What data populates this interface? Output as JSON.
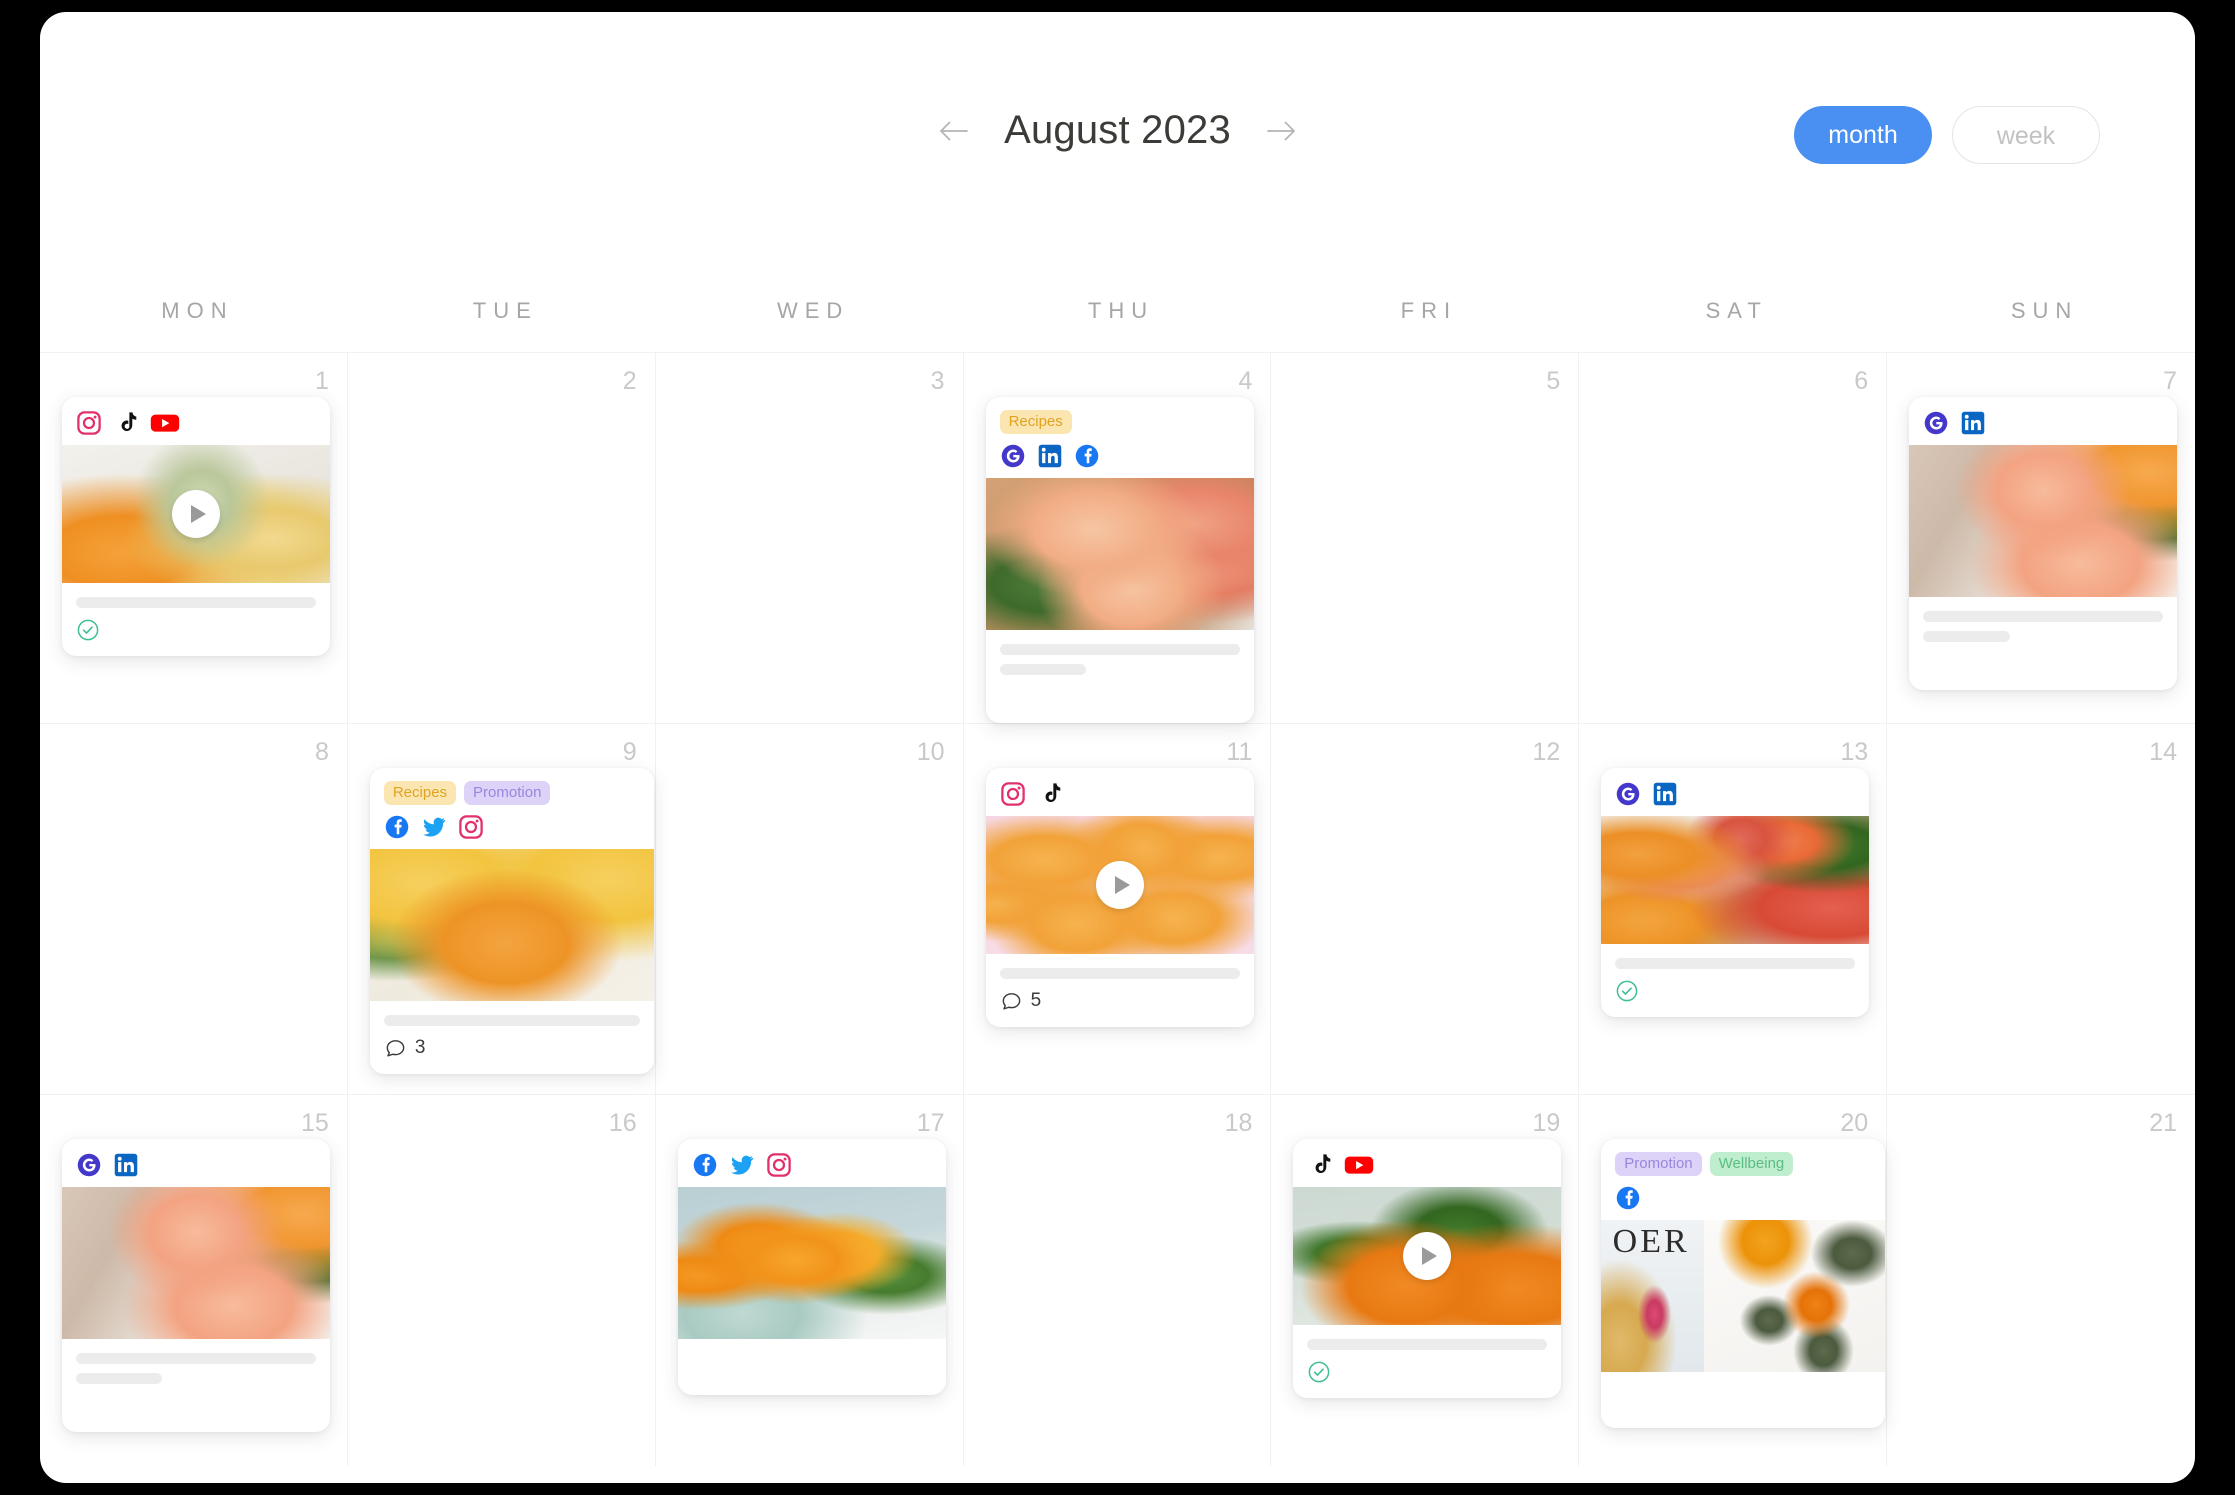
{
  "header": {
    "month_title": "August 2023",
    "prev_label": "previous month",
    "next_label": "next month",
    "view_month": "month",
    "view_week": "week"
  },
  "weekdays": [
    "MON",
    "TUE",
    "WED",
    "THU",
    "FRI",
    "SAT",
    "SUN"
  ],
  "colors": {
    "accent": "#4a90f2",
    "tag_recipes_bg": "#fbe6b2",
    "tag_recipes_fg": "#e0a321",
    "tag_promotion_bg": "#ddd2f7",
    "tag_promotion_fg": "#9b86dd",
    "tag_wellbeing_bg": "#bfeecf",
    "tag_wellbeing_fg": "#5bbd84",
    "status_approved": "#3fbf8f",
    "grid_line": "#f1f1f1",
    "date_number": "#c9c9c9"
  },
  "days": [
    {
      "date": "1",
      "post": {
        "tags": [],
        "socials": [
          "instagram",
          "tiktok",
          "youtube"
        ],
        "media": "pineapple-melon-juice",
        "video": true,
        "bars": [
          "full"
        ],
        "status": "approved",
        "comments": null
      }
    },
    {
      "date": "2",
      "post": null
    },
    {
      "date": "3",
      "post": null
    },
    {
      "date": "4",
      "post": {
        "tags": [
          "Recipes"
        ],
        "socials": [
          "google",
          "linkedin",
          "facebook"
        ],
        "media": "grapefruit-cocktails-board",
        "video": false,
        "bars": [
          "full",
          "short"
        ],
        "status": null,
        "comments": null
      }
    },
    {
      "date": "5",
      "post": null
    },
    {
      "date": "6",
      "post": null
    },
    {
      "date": "7",
      "post": {
        "tags": [],
        "socials": [
          "google",
          "linkedin"
        ],
        "media": "grapefruit-cocktails-linen",
        "video": false,
        "bars": [
          "full",
          "short"
        ],
        "status": null,
        "comments": null
      }
    },
    {
      "date": "8",
      "post": null
    },
    {
      "date": "9",
      "post": {
        "tags": [
          "Recipes",
          "Promotion"
        ],
        "socials": [
          "facebook",
          "twitter",
          "instagram"
        ],
        "media": "mango-smoothie-glass",
        "video": false,
        "bars": [
          "full"
        ],
        "status": null,
        "comments": "3"
      }
    },
    {
      "date": "10",
      "post": null
    },
    {
      "date": "11",
      "post": {
        "tags": [],
        "socials": [
          "instagram",
          "tiktok"
        ],
        "media": "mango-chips-pink",
        "video": true,
        "bars": [
          "full"
        ],
        "status": null,
        "comments": "5"
      }
    },
    {
      "date": "12",
      "post": null
    },
    {
      "date": "13",
      "post": {
        "tags": [],
        "socials": [
          "google",
          "linkedin"
        ],
        "media": "citrus-cutting-board",
        "video": false,
        "bars": [
          "full"
        ],
        "status": "approved",
        "comments": null
      }
    },
    {
      "date": "14",
      "post": null
    },
    {
      "date": "15",
      "post": {
        "tags": [],
        "socials": [
          "google",
          "linkedin"
        ],
        "media": "grapefruit-cocktails-linen",
        "video": false,
        "bars": [
          "full",
          "short"
        ],
        "status": null,
        "comments": null
      }
    },
    {
      "date": "16",
      "post": null
    },
    {
      "date": "17",
      "post": {
        "tags": [],
        "socials": [
          "facebook",
          "twitter",
          "instagram"
        ],
        "media": "oranges-cake-stand",
        "video": false,
        "bars": [],
        "status": null,
        "comments": null
      }
    },
    {
      "date": "18",
      "post": null
    },
    {
      "date": "19",
      "post": {
        "tags": [],
        "socials": [
          "tiktok",
          "youtube"
        ],
        "media": "oranges-branch",
        "video": true,
        "bars": [
          "full"
        ],
        "status": "approved",
        "comments": null
      }
    },
    {
      "date": "20",
      "post": {
        "tags": [
          "Promotion",
          "Wellbeing"
        ],
        "socials": [
          "facebook"
        ],
        "media": "magazine-orange-tea",
        "video": false,
        "bars": [],
        "status": null,
        "comments": null,
        "media_text": "OER"
      }
    },
    {
      "date": "21",
      "post": null
    }
  ]
}
